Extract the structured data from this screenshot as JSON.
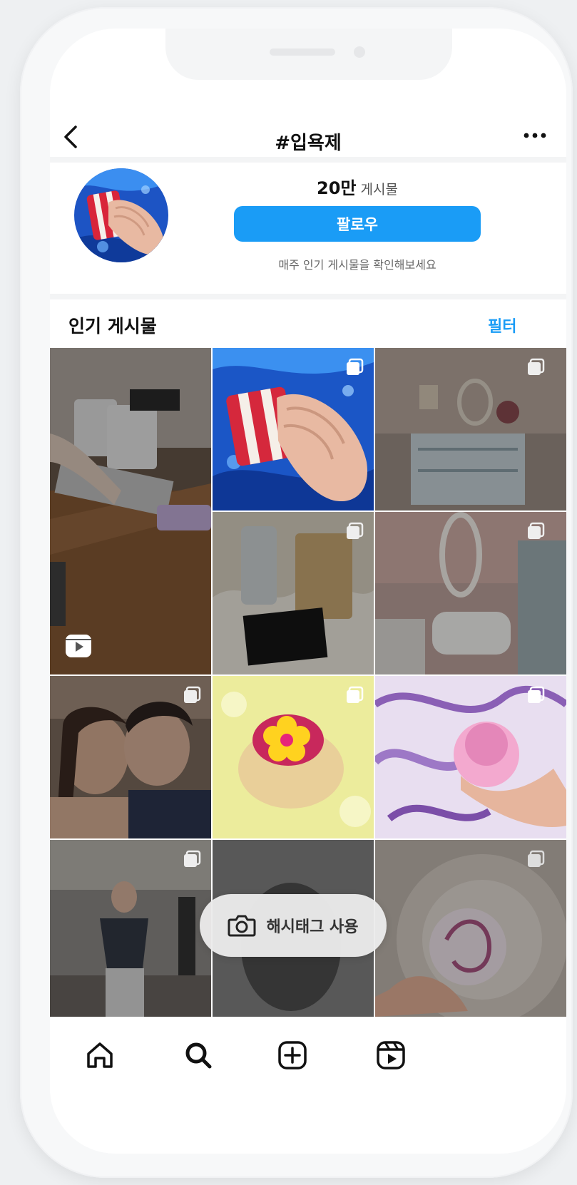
{
  "header": {
    "title": "#입욕제"
  },
  "profile": {
    "post_count": "20만",
    "post_label": "게시물",
    "follow_label": "팔로우",
    "weekly_text": "매주 인기 게시물을 확인해보세요"
  },
  "section": {
    "title": "인기 게시물",
    "filter_label": "필터"
  },
  "floating_button": {
    "label": "해시태그 사용"
  },
  "colors": {
    "accent": "#1a9cf6"
  },
  "icons": {
    "back": "back-arrow-icon",
    "more": "more-dots-icon",
    "reels_badge": "reels-icon",
    "multi": "multi-photo-icon",
    "camera": "camera-icon",
    "tabs": [
      "home-icon",
      "search-icon",
      "create-plus-icon",
      "reels-icon"
    ]
  }
}
